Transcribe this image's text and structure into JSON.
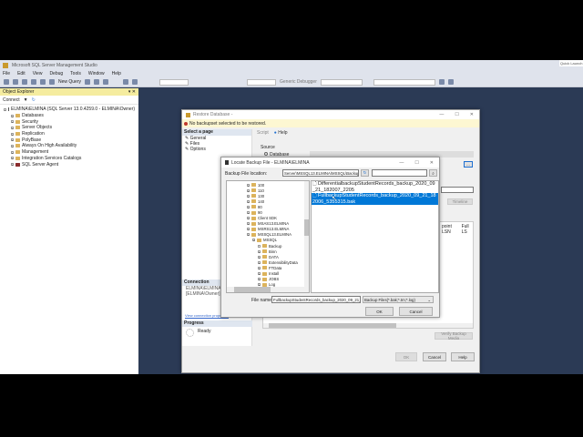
{
  "app": {
    "title": "Microsoft SQL Server Management Studio",
    "quick_launch": "Quick Launch",
    "menu": [
      "File",
      "Edit",
      "View",
      "Debug",
      "Tools",
      "Window",
      "Help"
    ],
    "toolbar": {
      "new_query": "New Query",
      "debugger": "Generic Debugger"
    }
  },
  "object_explorer": {
    "title": "Object Explorer",
    "connect": "Connect",
    "server": "ELMINA\\ELMINA (SQL Server 13.0.4259.0 - ELMINA\\Owner)",
    "nodes": [
      "Databases",
      "Security",
      "Server Objects",
      "Replication",
      "PolyBase",
      "Always On High Availability",
      "Management",
      "Integration Services Catalogs",
      "SQL Server Agent"
    ]
  },
  "restore": {
    "title": "Restore Database -",
    "notice": "No backupset selected to be restored.",
    "select_page": "Select a page",
    "pages": [
      "General",
      "Files",
      "Options"
    ],
    "script": "Script",
    "help_link": "Help",
    "source": "Source",
    "database_radio": "Database",
    "browse": "...",
    "timeline": "Timeline",
    "grid_headers": [
      "point LSN",
      "Full LS"
    ],
    "connection_header": "Connection",
    "connection_server": "ELMINA\\ELMINA",
    "connection_user": "[ELMINA\\Owner]",
    "view_conn": "View connection properties",
    "progress_header": "Progress",
    "progress_status": "Ready",
    "verify": "Verify Backup Media",
    "ok": "OK",
    "cancel": "Cancel",
    "help": "Help"
  },
  "locate": {
    "title": "Locate Backup File - ELMINA\\ELMINA",
    "location_label": "Backup File location:",
    "location_value": "Server\\MSSQL13.ELMINA\\MSSQL\\Backup",
    "tree": [
      {
        "label": "100",
        "level": 0
      },
      {
        "label": "110",
        "level": 0
      },
      {
        "label": "130",
        "level": 0
      },
      {
        "label": "140",
        "level": 0
      },
      {
        "label": "80",
        "level": 0
      },
      {
        "label": "90",
        "level": 0
      },
      {
        "label": "Client SDK",
        "level": 0
      },
      {
        "label": "MSAS13.ELMINA",
        "level": 0
      },
      {
        "label": "MSRS13.ELMINA",
        "level": 0
      },
      {
        "label": "MSSQL13.ELMINA",
        "level": 0
      },
      {
        "label": "MSSQL",
        "level": 1
      },
      {
        "label": "Backup",
        "level": 2
      },
      {
        "label": "Binn",
        "level": 2
      },
      {
        "label": "DATA",
        "level": 2
      },
      {
        "label": "ExtensibilityData",
        "level": 2
      },
      {
        "label": "FTData",
        "level": 2
      },
      {
        "label": "Install",
        "level": 2
      },
      {
        "label": "JOBS",
        "level": 2
      },
      {
        "label": "Log",
        "level": 2
      }
    ],
    "files": [
      "DifferentialbackupStudentRecords_backup_2020_09_21_182007_2205",
      "FullbackupStudentRecords_backup_2020_09_21_182006_5355315.bak"
    ],
    "file_name_label": "File name:",
    "file_name_value": "FullbackupStudentRecords_backup_2020_09_21_18",
    "file_type": "Backup Files(*.bak;*.tm;*.log)",
    "ok": "OK",
    "cancel": "Cancel"
  },
  "colors": {
    "workspace": "#2b3a55",
    "selection": "#0078d7",
    "notice": "#fdf7d2"
  }
}
